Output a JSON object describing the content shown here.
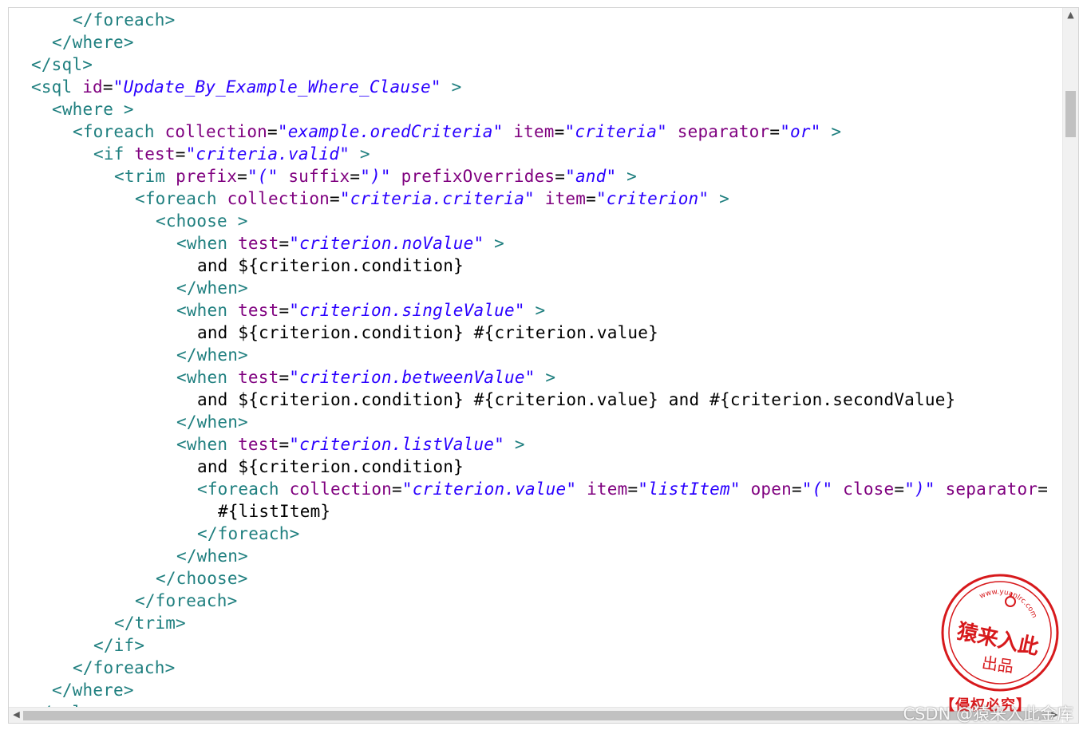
{
  "editor": {
    "lines": [
      {
        "indent": 2,
        "parts": [
          {
            "t": "tag",
            "v": "</foreach>"
          }
        ]
      },
      {
        "indent": 1,
        "parts": [
          {
            "t": "tag",
            "v": "</where>"
          }
        ]
      },
      {
        "indent": 0,
        "parts": [
          {
            "t": "tag",
            "v": "</sql>"
          }
        ]
      },
      {
        "indent": 0,
        "parts": [
          {
            "t": "tag",
            "v": "<sql "
          },
          {
            "t": "attr",
            "v": "id"
          },
          {
            "t": "txt",
            "v": "="
          },
          {
            "t": "val",
            "v": "\"Update_By_Example_Where_Clause\""
          },
          {
            "t": "tag",
            "v": " >"
          }
        ]
      },
      {
        "indent": 1,
        "parts": [
          {
            "t": "tag",
            "v": "<where >"
          }
        ]
      },
      {
        "indent": 2,
        "parts": [
          {
            "t": "tag",
            "v": "<foreach "
          },
          {
            "t": "attr",
            "v": "collection"
          },
          {
            "t": "txt",
            "v": "="
          },
          {
            "t": "val",
            "v": "\"example.oredCriteria\""
          },
          {
            "t": "txt",
            "v": " "
          },
          {
            "t": "attr",
            "v": "item"
          },
          {
            "t": "txt",
            "v": "="
          },
          {
            "t": "val",
            "v": "\"criteria\""
          },
          {
            "t": "txt",
            "v": " "
          },
          {
            "t": "attr",
            "v": "separator"
          },
          {
            "t": "txt",
            "v": "="
          },
          {
            "t": "val",
            "v": "\"or\""
          },
          {
            "t": "tag",
            "v": " >"
          }
        ]
      },
      {
        "indent": 3,
        "parts": [
          {
            "t": "tag",
            "v": "<if "
          },
          {
            "t": "attr",
            "v": "test"
          },
          {
            "t": "txt",
            "v": "="
          },
          {
            "t": "val",
            "v": "\"criteria.valid\""
          },
          {
            "t": "tag",
            "v": " >"
          }
        ]
      },
      {
        "indent": 4,
        "parts": [
          {
            "t": "tag",
            "v": "<trim "
          },
          {
            "t": "attr",
            "v": "prefix"
          },
          {
            "t": "txt",
            "v": "="
          },
          {
            "t": "val",
            "v": "\"(\""
          },
          {
            "t": "txt",
            "v": " "
          },
          {
            "t": "attr",
            "v": "suffix"
          },
          {
            "t": "txt",
            "v": "="
          },
          {
            "t": "val",
            "v": "\")\""
          },
          {
            "t": "txt",
            "v": " "
          },
          {
            "t": "attr",
            "v": "prefixOverrides"
          },
          {
            "t": "txt",
            "v": "="
          },
          {
            "t": "val",
            "v": "\"and\""
          },
          {
            "t": "tag",
            "v": " >"
          }
        ]
      },
      {
        "indent": 5,
        "parts": [
          {
            "t": "tag",
            "v": "<foreach "
          },
          {
            "t": "attr",
            "v": "collection"
          },
          {
            "t": "txt",
            "v": "="
          },
          {
            "t": "val",
            "v": "\"criteria.criteria\""
          },
          {
            "t": "txt",
            "v": " "
          },
          {
            "t": "attr",
            "v": "item"
          },
          {
            "t": "txt",
            "v": "="
          },
          {
            "t": "val",
            "v": "\"criterion\""
          },
          {
            "t": "tag",
            "v": " >"
          }
        ]
      },
      {
        "indent": 6,
        "parts": [
          {
            "t": "tag",
            "v": "<choose >"
          }
        ]
      },
      {
        "indent": 7,
        "parts": [
          {
            "t": "tag",
            "v": "<when "
          },
          {
            "t": "attr",
            "v": "test"
          },
          {
            "t": "txt",
            "v": "="
          },
          {
            "t": "val",
            "v": "\"criterion.noValue\""
          },
          {
            "t": "tag",
            "v": " >"
          }
        ]
      },
      {
        "indent": 8,
        "parts": [
          {
            "t": "txt",
            "v": "and ${criterion.condition}"
          }
        ]
      },
      {
        "indent": 7,
        "parts": [
          {
            "t": "tag",
            "v": "</when>"
          }
        ]
      },
      {
        "indent": 7,
        "parts": [
          {
            "t": "tag",
            "v": "<when "
          },
          {
            "t": "attr",
            "v": "test"
          },
          {
            "t": "txt",
            "v": "="
          },
          {
            "t": "val",
            "v": "\"criterion.singleValue\""
          },
          {
            "t": "tag",
            "v": " >"
          }
        ]
      },
      {
        "indent": 8,
        "parts": [
          {
            "t": "txt",
            "v": "and ${criterion.condition} #{criterion.value}"
          }
        ]
      },
      {
        "indent": 7,
        "parts": [
          {
            "t": "tag",
            "v": "</when>"
          }
        ]
      },
      {
        "indent": 7,
        "parts": [
          {
            "t": "tag",
            "v": "<when "
          },
          {
            "t": "attr",
            "v": "test"
          },
          {
            "t": "txt",
            "v": "="
          },
          {
            "t": "val",
            "v": "\"criterion.betweenValue\""
          },
          {
            "t": "tag",
            "v": " >"
          }
        ]
      },
      {
        "indent": 8,
        "parts": [
          {
            "t": "txt",
            "v": "and ${criterion.condition} #{criterion.value} and #{criterion.secondValue}"
          }
        ]
      },
      {
        "indent": 7,
        "parts": [
          {
            "t": "tag",
            "v": "</when>"
          }
        ]
      },
      {
        "indent": 7,
        "parts": [
          {
            "t": "tag",
            "v": "<when "
          },
          {
            "t": "attr",
            "v": "test"
          },
          {
            "t": "txt",
            "v": "="
          },
          {
            "t": "val",
            "v": "\"criterion.listValue\""
          },
          {
            "t": "tag",
            "v": " >"
          }
        ]
      },
      {
        "indent": 8,
        "parts": [
          {
            "t": "txt",
            "v": "and ${criterion.condition}"
          }
        ]
      },
      {
        "indent": 8,
        "parts": [
          {
            "t": "tag",
            "v": "<foreach "
          },
          {
            "t": "attr",
            "v": "collection"
          },
          {
            "t": "txt",
            "v": "="
          },
          {
            "t": "val",
            "v": "\"criterion.value\""
          },
          {
            "t": "txt",
            "v": " "
          },
          {
            "t": "attr",
            "v": "item"
          },
          {
            "t": "txt",
            "v": "="
          },
          {
            "t": "val",
            "v": "\"listItem\""
          },
          {
            "t": "txt",
            "v": " "
          },
          {
            "t": "attr",
            "v": "open"
          },
          {
            "t": "txt",
            "v": "="
          },
          {
            "t": "val",
            "v": "\"(\""
          },
          {
            "t": "txt",
            "v": " "
          },
          {
            "t": "attr",
            "v": "close"
          },
          {
            "t": "txt",
            "v": "="
          },
          {
            "t": "val",
            "v": "\")\""
          },
          {
            "t": "txt",
            "v": " "
          },
          {
            "t": "attr",
            "v": "separator"
          },
          {
            "t": "txt",
            "v": "="
          }
        ]
      },
      {
        "indent": 9,
        "parts": [
          {
            "t": "txt",
            "v": "#{listItem}"
          }
        ]
      },
      {
        "indent": 8,
        "parts": [
          {
            "t": "tag",
            "v": "</foreach>"
          }
        ]
      },
      {
        "indent": 7,
        "parts": [
          {
            "t": "tag",
            "v": "</when>"
          }
        ]
      },
      {
        "indent": 6,
        "parts": [
          {
            "t": "tag",
            "v": "</choose>"
          }
        ]
      },
      {
        "indent": 5,
        "parts": [
          {
            "t": "tag",
            "v": "</foreach>"
          }
        ]
      },
      {
        "indent": 4,
        "parts": [
          {
            "t": "tag",
            "v": "</trim>"
          }
        ]
      },
      {
        "indent": 3,
        "parts": [
          {
            "t": "tag",
            "v": "</if>"
          }
        ]
      },
      {
        "indent": 2,
        "parts": [
          {
            "t": "tag",
            "v": "</foreach>"
          }
        ]
      },
      {
        "indent": 1,
        "parts": [
          {
            "t": "tag",
            "v": "</where>"
          }
        ]
      },
      {
        "indent": 0,
        "parts": [
          {
            "t": "tag",
            "v": "</sql>"
          }
        ]
      }
    ]
  },
  "colors": {
    "tag": "#1f7f7f",
    "attribute": "#7f007f",
    "value": "#2a00ff",
    "text": "#000000",
    "stamp": "#d7191c"
  },
  "scrollbar": {
    "up_arrow": "▲",
    "down_arrow": "▼",
    "left_arrow": "◀",
    "right_arrow": "▶"
  },
  "stamp": {
    "url": "www.yuanlrc.com",
    "name": "猿来入此",
    "sub": "出品",
    "warning": "【侵权必究】",
    "icon": "apple-icon"
  },
  "watermark": {
    "text": "CSDN @猿来入此金库"
  }
}
